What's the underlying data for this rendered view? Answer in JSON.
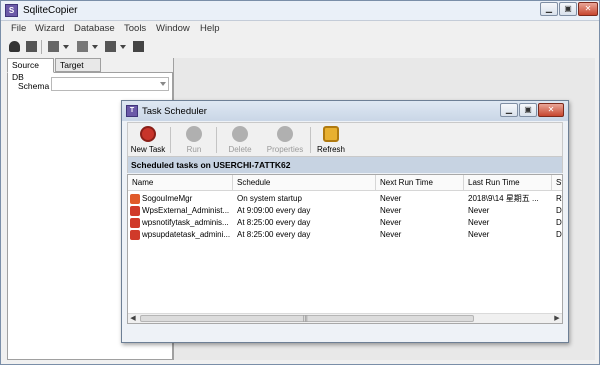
{
  "app": {
    "title": "SqliteCopier",
    "icon_glyph": "S",
    "icon_color": "#6b5aa8",
    "window_buttons": [
      "▁",
      "▣",
      "✕"
    ]
  },
  "menu": [
    "File",
    "Wizard",
    "Database",
    "Tools",
    "Window",
    "Help"
  ],
  "left_panel": {
    "tabs": [
      {
        "label": "Source DB",
        "active": true
      },
      {
        "label": "Target DB",
        "active": false
      }
    ],
    "schema_label": "Schema",
    "schema_value": ""
  },
  "dialog": {
    "title": "Task Scheduler",
    "icon_glyph": "T",
    "window_buttons": [
      "▁",
      "▣",
      "✕"
    ],
    "toolbar": [
      {
        "label": "New Task",
        "icon": "new-task-icon",
        "enabled": true,
        "color": "#2f9a2f"
      },
      {
        "label": "Run",
        "icon": "run-icon",
        "enabled": false,
        "color": "#a8a8a8"
      },
      {
        "label": "Delete",
        "icon": "delete-icon",
        "enabled": false,
        "color": "#a8a8a8"
      },
      {
        "label": "Properties",
        "icon": "properties-icon",
        "enabled": false,
        "color": "#a8a8a8"
      },
      {
        "label": "Refresh",
        "icon": "refresh-icon",
        "enabled": true,
        "color": "#e0a020"
      }
    ],
    "header": "Scheduled tasks on USERCHI-7ATTK62",
    "columns": [
      "Name",
      "Schedule",
      "Next Run Time",
      "Last Run Time",
      "Sta"
    ],
    "rows": [
      {
        "name": "SogouImeMgr",
        "schedule": "On system startup",
        "next": "Never",
        "last": "2018\\9\\14 星期五 ...",
        "status": "Re",
        "icon_color": "#e05a2a"
      },
      {
        "name": "WpsExternal_Administ...",
        "schedule": "At 9:09:00 every day",
        "next": "Never",
        "last": "Never",
        "status": "Dis",
        "icon_color": "#d03a2a"
      },
      {
        "name": "wpsnotifytask_adminis...",
        "schedule": "At 8:25:00 every day",
        "next": "Never",
        "last": "Never",
        "status": "Dis",
        "icon_color": "#d03a2a"
      },
      {
        "name": "wpsupdatetask_admini...",
        "schedule": "At 8:25:00 every day",
        "next": "Never",
        "last": "Never",
        "status": "Dis",
        "icon_color": "#d03a2a"
      }
    ]
  }
}
